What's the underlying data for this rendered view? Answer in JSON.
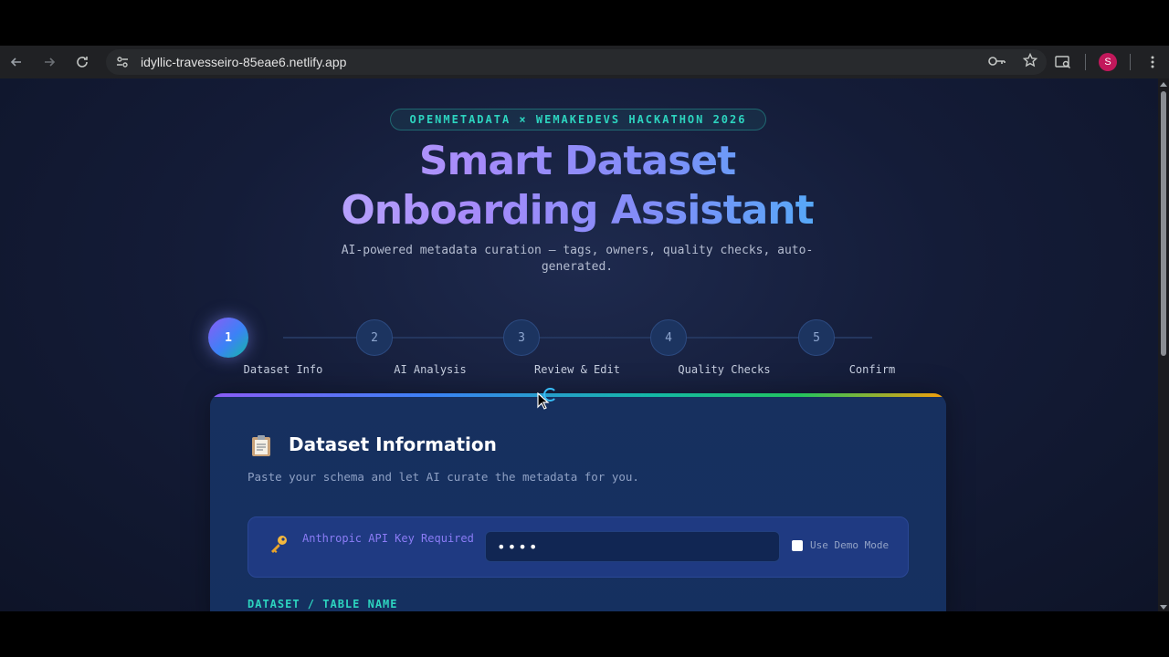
{
  "browser": {
    "url": "idyllic-travesseiro-85eae6.netlify.app",
    "profile_initial": "S",
    "icons": {
      "back": "back-arrow-icon",
      "forward": "forward-arrow-icon",
      "reload": "reload-icon",
      "site_info": "site-info-icon",
      "password": "key-icon",
      "bookmark": "star-icon",
      "lens": "search-page-icon",
      "menu": "kebab-menu-icon"
    }
  },
  "hero": {
    "badge": "OPENMETADATA × WEMAKEDEVS HACKATHON 2026",
    "title_line1": "Smart Dataset",
    "title_line2": "Onboarding Assistant",
    "subtitle_line1": "AI-powered metadata curation — tags, owners, quality checks, auto-",
    "subtitle_line2": "generated."
  },
  "stepper": {
    "active_step": 1,
    "steps": [
      {
        "number": "1",
        "label": "Dataset Info"
      },
      {
        "number": "2",
        "label": "AI Analysis"
      },
      {
        "number": "3",
        "label": "Review & Edit"
      },
      {
        "number": "4",
        "label": "Quality Checks"
      },
      {
        "number": "5",
        "label": "Confirm"
      }
    ]
  },
  "card": {
    "icon": "clipboard-icon",
    "title": "Dataset Information",
    "description": "Paste your schema and let AI curate the metadata for you.",
    "api": {
      "icon": "key-icon",
      "label": "Anthropic API Key Required",
      "input_value": "••••",
      "demo_checked": false,
      "demo_label": "Use Demo Mode"
    },
    "next_field_label": "DATASET / TABLE NAME"
  },
  "colors": {
    "accent_teal": "#2dd4bf",
    "accent_purple": "#8b5cf6",
    "accent_blue": "#3b82f6",
    "card_bg": "#17305f",
    "page_bg": "#141c38"
  }
}
